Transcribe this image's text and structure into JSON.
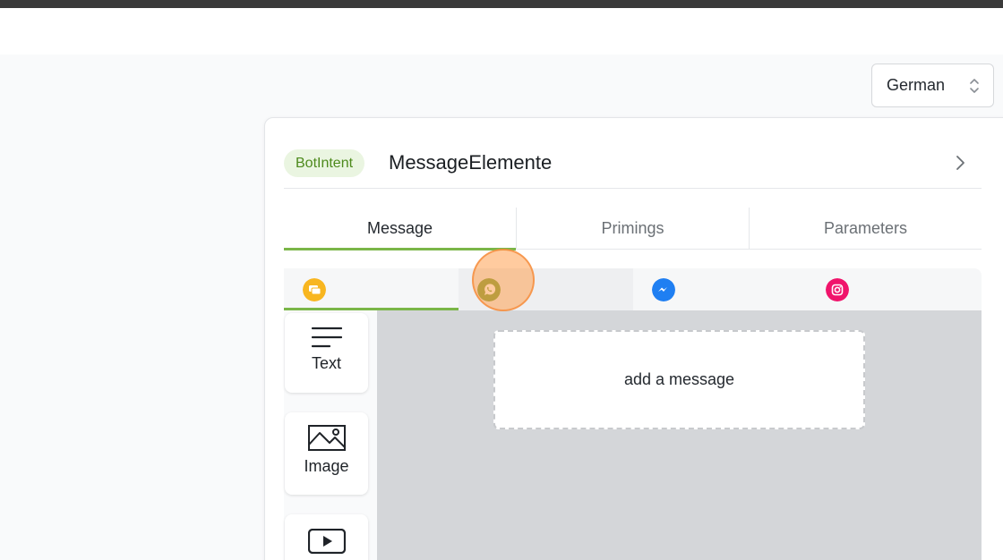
{
  "language_select": {
    "value": "German"
  },
  "intent": {
    "badge": "BotIntent",
    "title": "MessageElemente"
  },
  "tabs": [
    {
      "label": "Message",
      "active": true
    },
    {
      "label": "Primings",
      "active": false
    },
    {
      "label": "Parameters",
      "active": false
    }
  ],
  "channels": [
    {
      "name": "webchat-icon",
      "color": "#f8b620",
      "active": true
    },
    {
      "name": "whatsapp-icon",
      "color": "#8ba63a",
      "active": false
    },
    {
      "name": "messenger-icon",
      "color": "#1f7ff2",
      "active": false
    },
    {
      "name": "instagram-icon",
      "color": "#f0146b",
      "active": false
    }
  ],
  "tools": [
    {
      "label": "Text",
      "icon": "text-lines-icon"
    },
    {
      "label": "Image",
      "icon": "image-icon"
    },
    {
      "label": "",
      "icon": "video-play-icon"
    }
  ],
  "canvas": {
    "placeholder": "add a message"
  },
  "colors": {
    "accent": "#7ab648",
    "badge_bg": "#eaf5e1",
    "badge_text": "#4d8a1c",
    "canvas": "#d4d6d9"
  }
}
